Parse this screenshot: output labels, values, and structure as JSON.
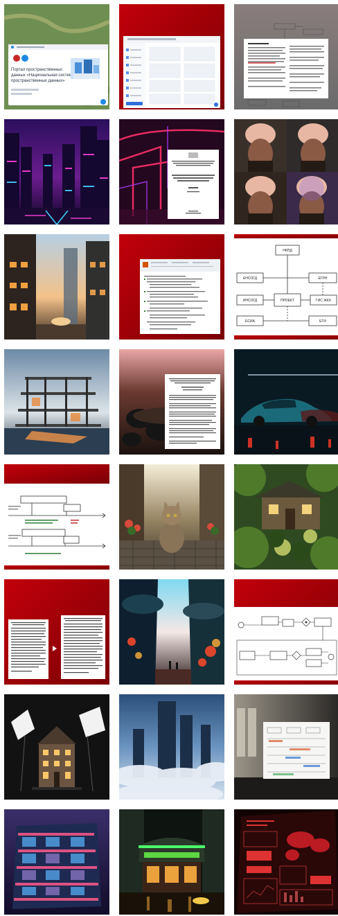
{
  "gallery": {
    "tiles": [
      {
        "kind": "map-portal",
        "title_lines": [
          "Портал пространственных",
          "данных «Национальная система",
          "пространственных данных»"
        ],
        "bg": "#6f8f52"
      },
      {
        "kind": "red-app",
        "bg": "#a30008"
      },
      {
        "kind": "doc-flowchart",
        "bg": "#7c7c7c"
      },
      {
        "kind": "neon-city",
        "bg": "#1d0b3a"
      },
      {
        "kind": "neon-doc",
        "bg": "#23081f"
      },
      {
        "kind": "brain-portraits",
        "bg": "#2a2420"
      },
      {
        "kind": "street-photo",
        "bg": "#3a3028"
      },
      {
        "kind": "red-doc",
        "bg": "#a30008"
      },
      {
        "kind": "white-diagram",
        "bg": "#ffffff",
        "labels": [
          "НКПД",
          "ЕНСОГД",
          "ЕГРН",
          "ИНСОГД",
          "ПРОЕКТ",
          "ГИС ЖКХ",
          "ЕСИА",
          "ЕГИ"
        ]
      },
      {
        "kind": "construction",
        "bg": "#8fa3b3"
      },
      {
        "kind": "meeting-doc",
        "bg": "#3d2720"
      },
      {
        "kind": "car-night",
        "bg": "#0a1a22"
      },
      {
        "kind": "timeline-diagram",
        "bg": "#a30008"
      },
      {
        "kind": "cat-street",
        "bg": "#7a6a4a"
      },
      {
        "kind": "green-house",
        "bg": "#2f4a20"
      },
      {
        "kind": "red-two-docs",
        "bg": "#a30008"
      },
      {
        "kind": "cyber-street",
        "bg": "#0e2030"
      },
      {
        "kind": "red-bpmn",
        "bg": "#a30008"
      },
      {
        "kind": "house-studio",
        "bg": "#121212"
      },
      {
        "kind": "cloud-city",
        "bg": "#3d6795"
      },
      {
        "kind": "office-board",
        "bg": "#4c4a46"
      },
      {
        "kind": "glass-building",
        "bg": "#1b1538"
      },
      {
        "kind": "neon-shop",
        "bg": "#0e1410"
      },
      {
        "kind": "red-dashboard",
        "bg": "#1a0606"
      }
    ]
  }
}
